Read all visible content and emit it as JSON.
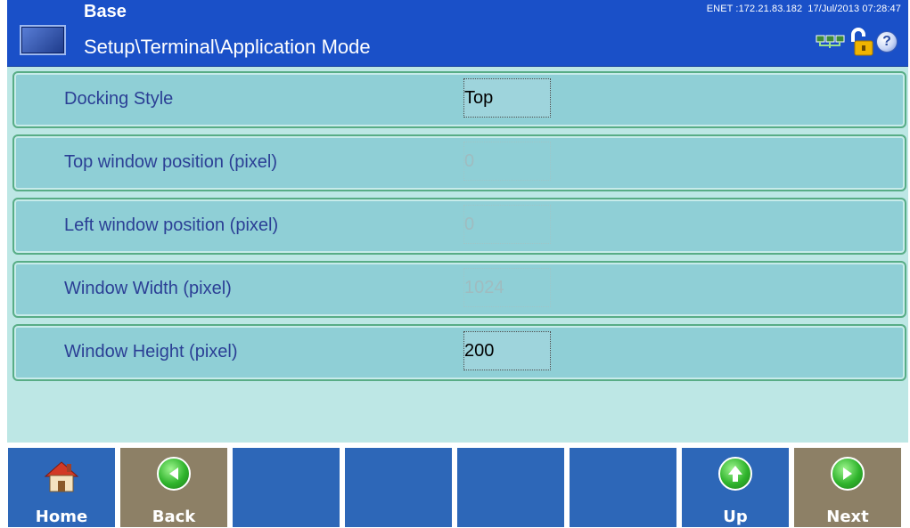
{
  "header": {
    "title": "Base",
    "subtitle": "Setup\\Terminal\\Application Mode",
    "network": "ENET :172.21.83.182",
    "datetime": "17/Jul/2013 07:28:47",
    "icons": [
      "network-icon",
      "unlocked-lock-icon",
      "help-icon"
    ]
  },
  "rows": [
    {
      "label": "Docking Style",
      "value": "Top",
      "enabled": true
    },
    {
      "label": "Top window position (pixel)",
      "value": "0",
      "enabled": false
    },
    {
      "label": "Left window position (pixel)",
      "value": "0",
      "enabled": false
    },
    {
      "label": "Window Width (pixel)",
      "value": "1024",
      "enabled": false
    },
    {
      "label": "Window Height (pixel)",
      "value": "200",
      "enabled": true
    }
  ],
  "softkeys": {
    "home": "Home",
    "back": "Back",
    "up": "Up",
    "next": "Next"
  },
  "colors": {
    "header": "#1a50c8",
    "background": "#bde7e5",
    "row": "#8fcfd6",
    "softkey_blue": "#2d67b8",
    "softkey_tan": "#8d8066"
  }
}
